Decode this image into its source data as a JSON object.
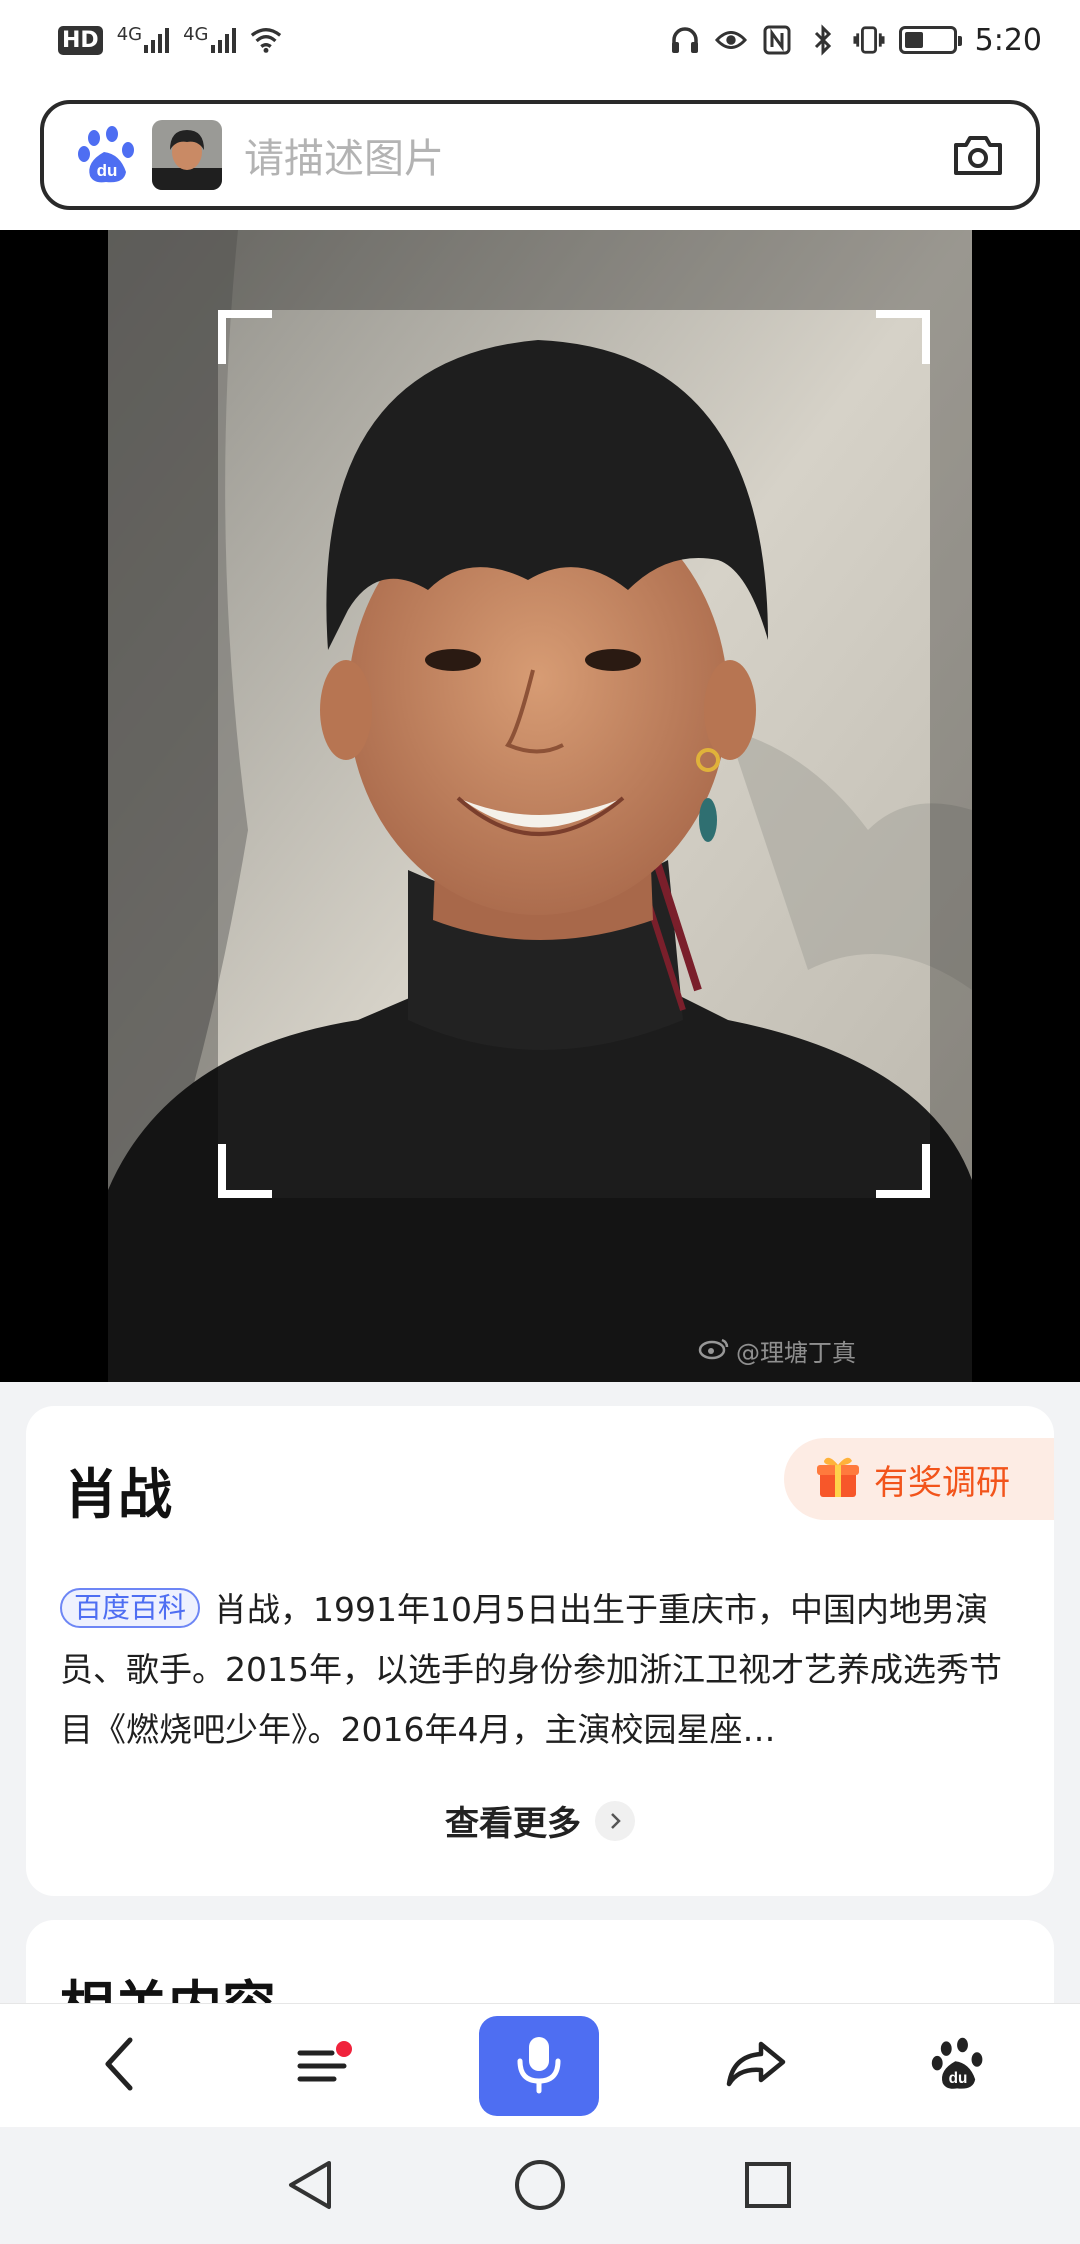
{
  "status_bar": {
    "hd_label": "HD",
    "sim1_label": "4G",
    "sim2_label": "4G",
    "time": "5:20",
    "battery_level": 0.4,
    "icons": [
      "headphones-icon",
      "eye-icon",
      "nfc-icon",
      "bluetooth-icon",
      "vibrate-icon",
      "battery-icon",
      "wifi-icon"
    ]
  },
  "search": {
    "placeholder": "请描述图片",
    "logo_text": "du"
  },
  "viewer": {
    "watermark": "@理塘丁真"
  },
  "result": {
    "name": "肖战",
    "survey_label": "有奖调研",
    "source_tag": "百度百科",
    "summary": "肖战，1991年10月5日出生于重庆市，中国内地男演员、歌手。2015年，以选手的身份参加浙江卫视才艺养成选秀节目《燃烧吧少年》。2016年4月，主演校园星座…",
    "more_label": "查看更多"
  },
  "related": {
    "title": "相关内容"
  },
  "toolbar": {
    "items": [
      "back-icon",
      "menu-icon",
      "microphone-icon",
      "share-icon",
      "baidu-icon"
    ],
    "accent": "#4e6ef2",
    "notification_color": "#f0233c"
  },
  "navbar": {
    "items": [
      "nav-back-icon",
      "nav-home-icon",
      "nav-recents-icon"
    ]
  }
}
